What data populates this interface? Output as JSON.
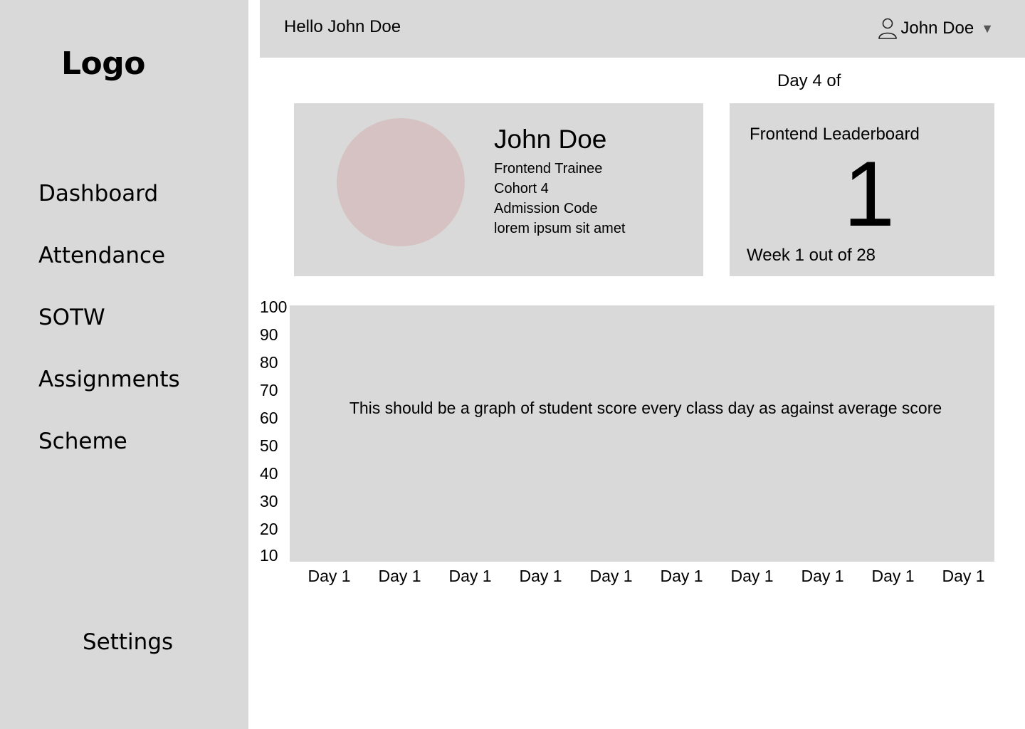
{
  "sidebar": {
    "logo": "Logo",
    "items": [
      {
        "label": "Dashboard"
      },
      {
        "label": "Attendance"
      },
      {
        "label": "SOTW"
      },
      {
        "label": "Assignments"
      },
      {
        "label": "Scheme"
      }
    ],
    "settings": "Settings"
  },
  "header": {
    "greeting": "Hello John Doe",
    "user_name": "John Doe",
    "user_icon": "user-icon",
    "caret_icon": "caret-down-icon"
  },
  "day_label": "Day 4 of",
  "profile": {
    "name": "John Doe",
    "role": "Frontend Trainee",
    "cohort": "Cohort 4",
    "admission_label": "Admission Code",
    "admission_value": "lorem ipsum sit amet",
    "avatar_color": "#d6c2c2"
  },
  "leaderboard": {
    "title": "Frontend Leaderboard",
    "rank": "1",
    "week": "Week 1 out of 28"
  },
  "chart": {
    "note": "This should be a graph of student score every class day as against average score",
    "y_ticks": [
      "100",
      "90",
      "80",
      "70",
      "60",
      "50",
      "40",
      "30",
      "20",
      "10"
    ],
    "x_ticks": [
      "Day 1",
      "Day 1",
      "Day 1",
      "Day 1",
      "Day 1",
      "Day 1",
      "Day 1",
      "Day 1",
      "Day 1",
      "Day 1"
    ]
  },
  "colors": {
    "panel": "#d9d9d9",
    "background": "#ffffff"
  }
}
